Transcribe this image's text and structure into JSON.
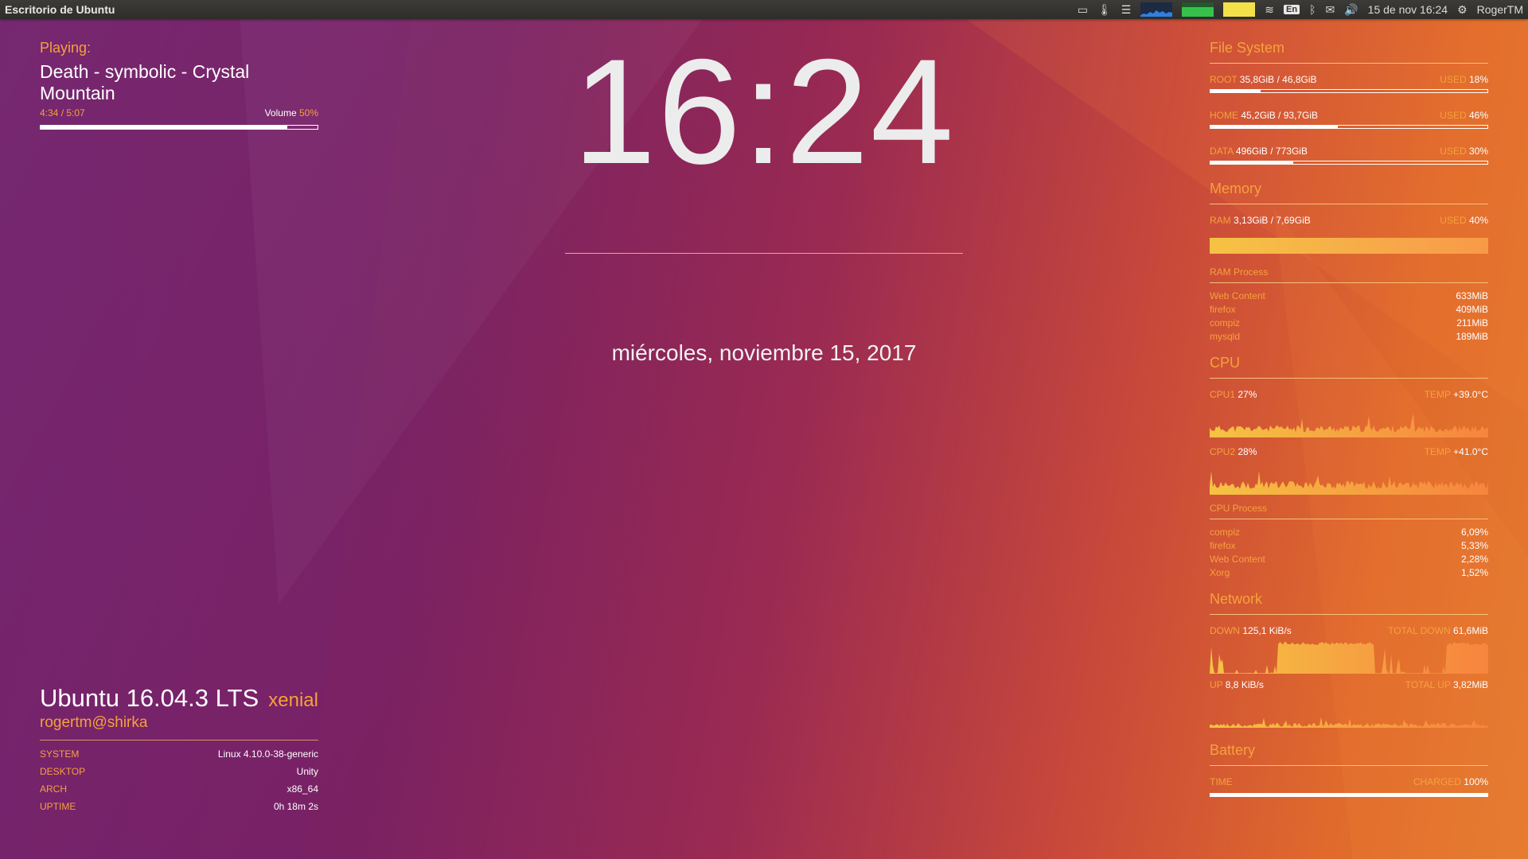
{
  "panel": {
    "title": "Escritorio de Ubuntu",
    "keyboard": "En",
    "datetime": "15 de nov 16:24",
    "user": "RogerTM"
  },
  "music": {
    "playing_label": "Playing:",
    "song": "Death - symbolic - Crystal Mountain",
    "time": "4:34 / 5:07",
    "volume_label": "Volume",
    "volume_value": "50%",
    "progress": 0.89
  },
  "clock": {
    "time": "16:24",
    "date": "miércoles, noviembre 15, 2017"
  },
  "system": {
    "distro": "Ubuntu 16.04.3 LTS",
    "codename": "xenial",
    "user": "rogertm@shirka",
    "rows": [
      {
        "key": "SYSTEM",
        "value": "Linux 4.10.0-38-generic"
      },
      {
        "key": "DESKTOP",
        "value": "Unity"
      },
      {
        "key": "ARCH",
        "value": "x86_64"
      },
      {
        "key": "UPTIME",
        "value": "0h 18m 2s"
      }
    ]
  },
  "filesystem": {
    "title": "File System",
    "used_label": "USED",
    "items": [
      {
        "name": "ROOT",
        "size": "35,8GiB / 46,8GiB",
        "used": "18%",
        "fraction": 0.18
      },
      {
        "name": "HOME",
        "size": "45,2GiB / 93,7GiB",
        "used": "46%",
        "fraction": 0.46
      },
      {
        "name": "DATA",
        "size": "496GiB / 773GiB",
        "used": "30%",
        "fraction": 0.3
      }
    ]
  },
  "memory": {
    "title": "Memory",
    "ram_label": "RAM",
    "ram_value": "3,13GiB / 7,69GiB",
    "used_label": "USED",
    "used_value": "40%",
    "process_title": "RAM Process",
    "processes": [
      {
        "name": "Web Content",
        "value": "633MiB"
      },
      {
        "name": "firefox",
        "value": "409MiB"
      },
      {
        "name": "compiz",
        "value": "211MiB"
      },
      {
        "name": "mysqld",
        "value": "189MiB"
      }
    ]
  },
  "cpu": {
    "title": "CPU",
    "temp_label": "TEMP",
    "cores": [
      {
        "name": "CPU1",
        "usage": "27%",
        "temp": "+39.0°C"
      },
      {
        "name": "CPU2",
        "usage": "28%",
        "temp": "+41.0°C"
      }
    ],
    "process_title": "CPU Process",
    "processes": [
      {
        "name": "compiz",
        "value": "6,09%"
      },
      {
        "name": "firefox",
        "value": "5,33%"
      },
      {
        "name": "Web Content",
        "value": "2,28%"
      },
      {
        "name": "Xorg",
        "value": "1,52%"
      }
    ]
  },
  "network": {
    "title": "Network",
    "down_label": "DOWN",
    "down_value": "125,1 KiB/s",
    "total_down_label": "TOTAL DOWN",
    "total_down_value": "61,6MiB",
    "up_label": "UP",
    "up_value": "8,8 KiB/s",
    "total_up_label": "TOTAL UP",
    "total_up_value": "3,82MiB"
  },
  "battery": {
    "title": "Battery",
    "time_label": "TIME",
    "charged_label": "CHARGED",
    "charged_value": "100%",
    "fraction": 1.0
  },
  "colors": {
    "accent": "#f6a13c",
    "text": "#ffffff",
    "graph_a": "#f5c344",
    "graph_b": "#f7843e"
  }
}
